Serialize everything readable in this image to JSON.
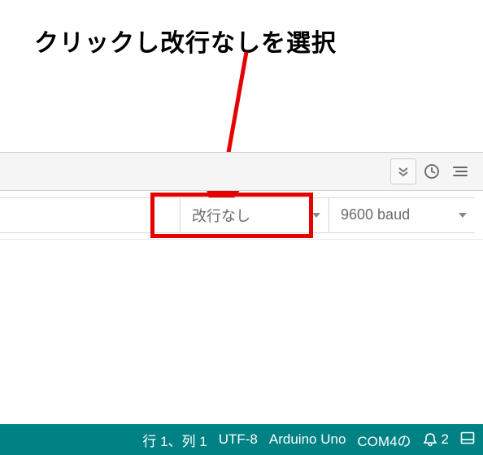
{
  "annotation": {
    "text": "クリックし改行なしを選択"
  },
  "toolbar": {
    "icons": [
      "chevrons-down-icon",
      "clock-icon",
      "list-icon"
    ]
  },
  "serial_monitor": {
    "line_ending": {
      "selected": "改行なし"
    },
    "baud": {
      "selected": "9600 baud"
    }
  },
  "status": {
    "position": "行 1、列 1",
    "encoding": "UTF-8",
    "board": "Arduino Uno",
    "port": "COM4の",
    "notifications_count": "2"
  }
}
